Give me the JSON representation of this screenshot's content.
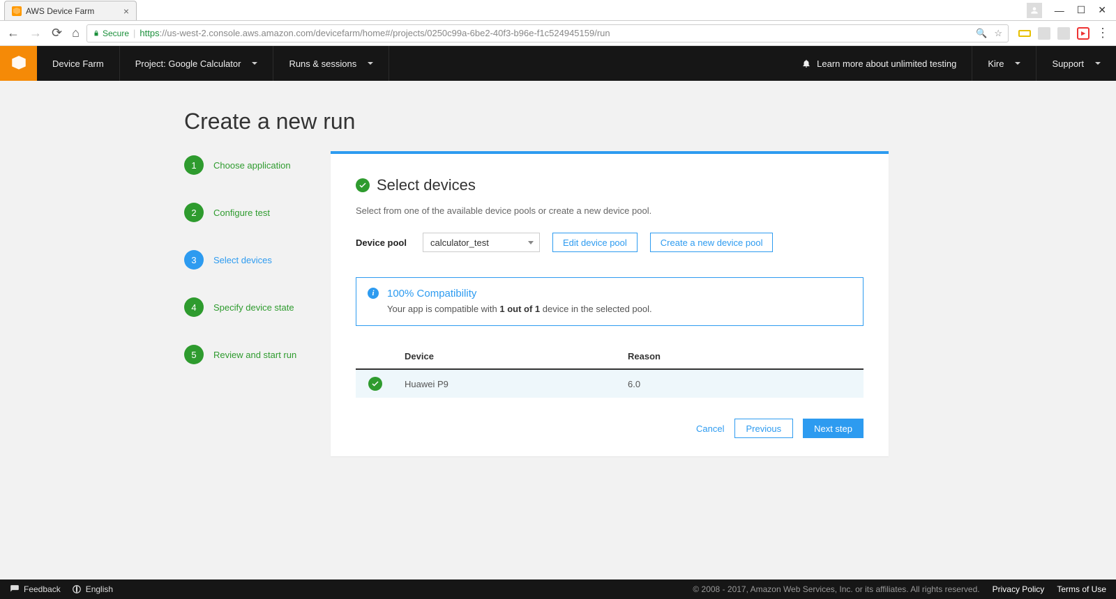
{
  "browser": {
    "tab_title": "AWS Device Farm",
    "secure_label": "Secure",
    "url_prefix": "https",
    "url_rest": "://us-west-2.console.aws.amazon.com/devicefarm/home#/projects/0250c99a-6be2-40f3-b96e-f1c524945159/run"
  },
  "nav": {
    "service": "Device Farm",
    "project": "Project: Google Calculator",
    "runs": "Runs & sessions",
    "learn_more": "Learn more about unlimited testing",
    "user": "Kire",
    "support": "Support"
  },
  "page_title": "Create a new run",
  "steps": [
    {
      "num": "1",
      "label": "Choose application",
      "state": "done"
    },
    {
      "num": "2",
      "label": "Configure test",
      "state": "done"
    },
    {
      "num": "3",
      "label": "Select devices",
      "state": "active"
    },
    {
      "num": "4",
      "label": "Specify device state",
      "state": "todo"
    },
    {
      "num": "5",
      "label": "Review and start run",
      "state": "todo"
    }
  ],
  "panel": {
    "title": "Select devices",
    "subtitle": "Select from one of the available device pools or create a new device pool.",
    "pool_label": "Device pool",
    "pool_value": "calculator_test",
    "edit_pool_btn": "Edit device pool",
    "create_pool_btn": "Create a new device pool",
    "info_title": "100% Compatibility",
    "info_body_pre": "Your app is compatible with ",
    "info_body_bold": "1 out of 1",
    "info_body_post": " device in the selected pool.",
    "col_device": "Device",
    "col_reason": "Reason",
    "row_device": "Huawei P9",
    "row_reason": "6.0",
    "cancel": "Cancel",
    "previous": "Previous",
    "next": "Next step"
  },
  "footer": {
    "feedback": "Feedback",
    "language": "English",
    "copyright": "© 2008 - 2017, Amazon Web Services, Inc. or its affiliates. All rights reserved.",
    "privacy": "Privacy Policy",
    "terms": "Terms of Use"
  }
}
